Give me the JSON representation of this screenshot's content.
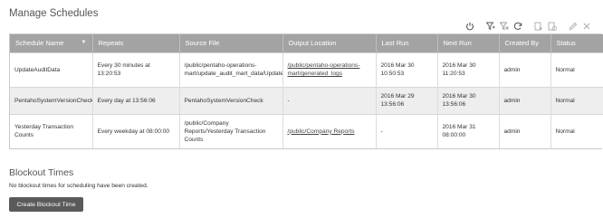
{
  "page": {
    "title": "Manage Schedules"
  },
  "toolbar": {
    "icons": [
      "power-icon",
      "filter-icon",
      "clear-filter-icon",
      "refresh-icon",
      "run-now-icon",
      "run-later-icon",
      "edit-icon",
      "delete-icon"
    ]
  },
  "table": {
    "columns": [
      "Schedule Name",
      "Repeats",
      "Source File",
      "Output Location",
      "Last Run",
      "Next Run",
      "Created By",
      "Status"
    ],
    "rows": [
      {
        "name": "UpdateAuditData",
        "repeats": "Every 30 minutes at 13:20:53",
        "source": "/public/pentaho-operations-mart/update_audit_mart_data/UpdateAuditData",
        "output": "/public/pentaho-operations-mart/generated_logs",
        "last_run": "2016 Mar 30 10:50:53",
        "next_run": "2016 Mar 30 11:20:53",
        "created_by": "admin",
        "status": "Normal"
      },
      {
        "name": "PentahoSystemVersionCheck",
        "repeats": "Every day at 13:56:06",
        "source": "PentahoSystemVersionCheck",
        "output": "-",
        "last_run": "2016 Mar 29 13:56:06",
        "next_run": "2016 Mar 30 13:56:06",
        "created_by": "admin",
        "status": "Normal"
      },
      {
        "name": "Yesterday Transaction Counts",
        "repeats": "Every weekday at 08:00:00",
        "source": "/public/Company Reports/Yesterday Transaction Counts",
        "output": "/public/Company Reports",
        "last_run": "-",
        "next_run": "2016 Mar 31 08:00:00",
        "created_by": "admin",
        "status": "Normal"
      }
    ]
  },
  "blockout": {
    "title": "Blockout Times",
    "message": "No blockout times for scheduling have been created.",
    "button_label": "Create Blockout Time"
  }
}
